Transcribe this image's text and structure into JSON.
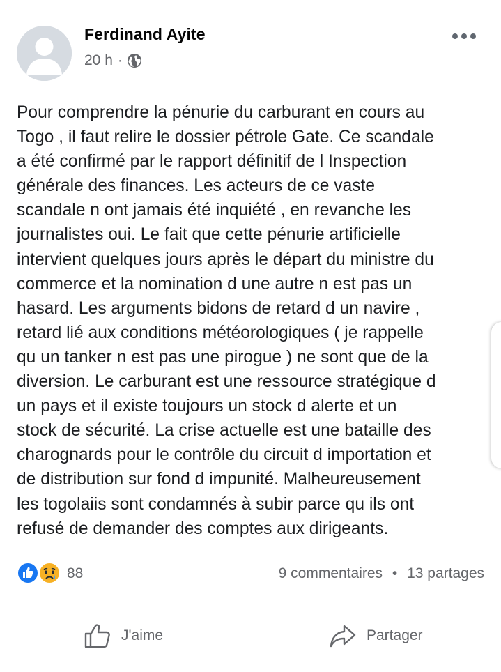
{
  "post": {
    "author": "Ferdinand Ayite",
    "time": "20 h",
    "separator": "·",
    "body": "Pour comprendre la pénurie du carburant en cours au\nTogo , il faut relire le dossier pétrole Gate. Ce scandale\na été confirmé par le rapport définitif de l Inspection\ngénérale des finances. Les acteurs de ce vaste\nscandale n ont jamais été inquiété , en revanche les\njournalistes oui. Le fait que cette pénurie artificielle\nintervient quelques jours après le départ du ministre du\ncommerce et la nomination d une autre n est pas un\nhasard. Les arguments bidons de retard d un navire ,\nretard lié aux conditions météorologiques ( je rappelle\nqu un tanker n est pas une pirogue ) ne sont que de la\ndiversion. Le carburant est une ressource stratégique d\nun pays et il existe toujours un stock d alerte et un\nstock de sécurité. La crise actuelle est une bataille des\ncharognards pour le contrôle du circuit d importation et\nde distribution sur fond d impunité. Malheureusement\nles togolaiis sont condamnés à subir parce qu ils ont\nrefusé de demander des comptes aux dirigeants."
  },
  "stats": {
    "reaction_count": "88",
    "comments": "9 commentaires",
    "dot": "•",
    "shares": "13 partages",
    "reactions": [
      "like-icon",
      "sad-icon"
    ]
  },
  "actions": {
    "like_label": "J'aime",
    "share_label": "Partager"
  },
  "colors": {
    "like_blue": "#1877f2",
    "sad_yellow": "#f7b125",
    "secondary_text": "#65676b"
  }
}
